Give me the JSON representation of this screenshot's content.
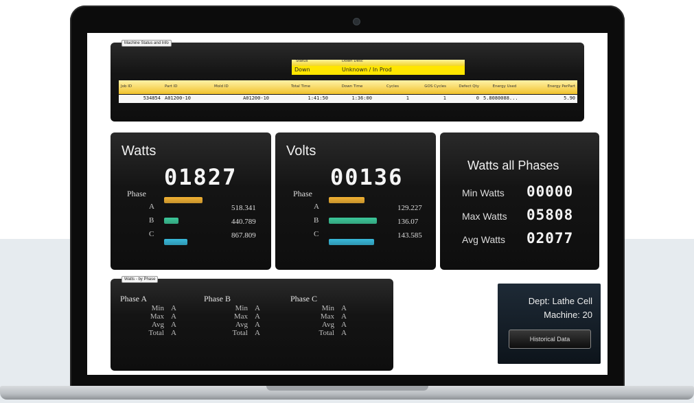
{
  "machine_status": {
    "tag": "Machine Status and Info",
    "status_header": [
      "Status",
      "Down Desc"
    ],
    "status_values": [
      "Down",
      "Unknown / In Prod"
    ],
    "columns": [
      "Job ID",
      "Part ID",
      "Mold ID",
      "Total Time",
      "Down Time",
      "Cycles",
      "GOS Cycles",
      "Defect Qty",
      "Energy Used",
      "Energy PerPart"
    ],
    "row": [
      "534854",
      "A01200-10",
      "A01200-10",
      "1:41:50",
      "1:36:00",
      "1",
      "1",
      "0",
      "5.8080088...",
      "5.90"
    ]
  },
  "watts": {
    "title": "Watts",
    "reading": "01827",
    "phase_label": "Phase",
    "phases": [
      {
        "name": "A",
        "value": "518.341",
        "level": 0.6,
        "color": "#f2b233"
      },
      {
        "name": "B",
        "value": "440.789",
        "level": 0.22,
        "color": "#3cc89a"
      },
      {
        "name": "C",
        "value": "867.809",
        "level": 0.36,
        "color": "#38b9db"
      }
    ]
  },
  "volts": {
    "title": "Volts",
    "reading": "00136",
    "phase_label": "Phase",
    "phases": [
      {
        "name": "A",
        "value": "129.227",
        "level": 0.55,
        "color": "#f2b233"
      },
      {
        "name": "B",
        "value": "136.07",
        "level": 0.74,
        "color": "#3cc89a"
      },
      {
        "name": "C",
        "value": "143.585",
        "level": 0.7,
        "color": "#38b9db"
      }
    ]
  },
  "watts_all": {
    "title": "Watts all Phases",
    "rows": [
      {
        "label": "Min Watts",
        "value": "00000"
      },
      {
        "label": "Max Watts",
        "value": "05808"
      },
      {
        "label": "Avg Watts",
        "value": "02077"
      }
    ]
  },
  "watts_by_phase": {
    "tag": "Watts - by Phase",
    "columns": [
      {
        "title": "Phase A",
        "rows": [
          {
            "k": "Min",
            "v": "A"
          },
          {
            "k": "Max",
            "v": "A"
          },
          {
            "k": "Avg",
            "v": "A"
          },
          {
            "k": "Total",
            "v": "A"
          }
        ]
      },
      {
        "title": "Phase B",
        "rows": [
          {
            "k": "Min",
            "v": "A"
          },
          {
            "k": "Max",
            "v": "A"
          },
          {
            "k": "Avg",
            "v": "A"
          },
          {
            "k": "Total",
            "v": "A"
          }
        ]
      },
      {
        "title": "Phase C",
        "rows": [
          {
            "k": "Min",
            "v": "A"
          },
          {
            "k": "Max",
            "v": "A"
          },
          {
            "k": "Avg",
            "v": "A"
          },
          {
            "k": "Total",
            "v": "A"
          }
        ]
      }
    ]
  },
  "dept": {
    "dept_line": "Dept: Lathe Cell",
    "machine_line": "Machine: 20",
    "button": "Historical Data"
  },
  "colors": {
    "accent_yellow": "#ffe600",
    "panel_dark": "#141414"
  }
}
